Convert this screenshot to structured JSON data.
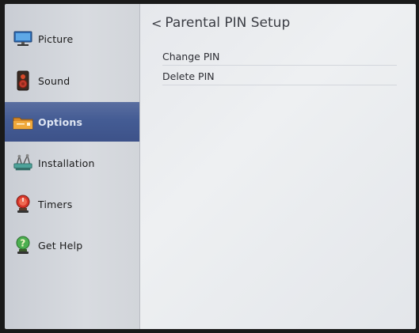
{
  "sidebar": {
    "items": [
      {
        "label": "Picture",
        "icon": "monitor-icon",
        "selected": false
      },
      {
        "label": "Sound",
        "icon": "speaker-icon",
        "selected": false
      },
      {
        "label": "Options",
        "icon": "options-folder-icon",
        "selected": true
      },
      {
        "label": "Installation",
        "icon": "antenna-icon",
        "selected": false
      },
      {
        "label": "Timers",
        "icon": "timer-icon",
        "selected": false
      },
      {
        "label": "Get Help",
        "icon": "help-icon",
        "selected": false
      }
    ]
  },
  "header": {
    "back_glyph": "<",
    "title": "Parental PIN Setup"
  },
  "menu": {
    "items": [
      {
        "label": "Change PIN"
      },
      {
        "label": "Delete PIN"
      }
    ]
  },
  "colors": {
    "selected_bg": "#445c94",
    "sidebar_bg": "#d2d5da",
    "content_bg": "#eceef1"
  }
}
